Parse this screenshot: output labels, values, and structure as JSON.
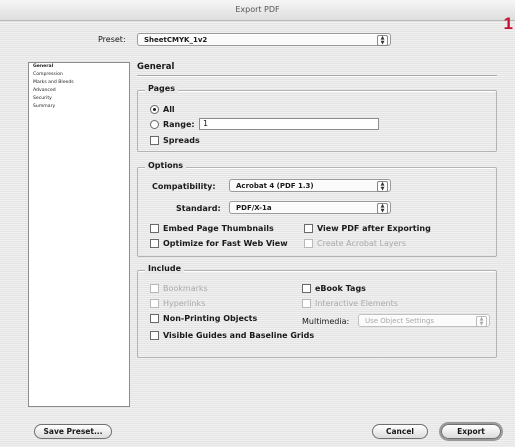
{
  "window": {
    "title": "Export PDF"
  },
  "badge": "1",
  "preset": {
    "label": "Preset:",
    "value": "SheetCMYK_1v2"
  },
  "sidebar": {
    "items": [
      {
        "label": "General"
      },
      {
        "label": "Compression"
      },
      {
        "label": "Marks and Bleeds"
      },
      {
        "label": "Advanced"
      },
      {
        "label": "Security"
      },
      {
        "label": "Summary"
      }
    ]
  },
  "panel": {
    "title": "General"
  },
  "pages": {
    "label": "Pages",
    "all_label": "All",
    "range_label": "Range:",
    "range_value": "1",
    "spreads_label": "Spreads"
  },
  "options": {
    "label": "Options",
    "compatibility_label": "Compatibility:",
    "compatibility_value": "Acrobat 4 (PDF 1.3)",
    "standard_label": "Standard:",
    "standard_value": "PDF/X-1a",
    "embed_thumbs": "Embed Page Thumbnails",
    "view_after": "View PDF after Exporting",
    "optimize": "Optimize for Fast Web View",
    "create_layers": "Create Acrobat Layers"
  },
  "include": {
    "label": "Include",
    "bookmarks": "Bookmarks",
    "ebook_tags": "eBook Tags",
    "hyperlinks": "Hyperlinks",
    "interactive": "Interactive Elements",
    "nonprinting": "Non-Printing Objects",
    "multimedia_label": "Multimedia:",
    "multimedia_value": "Use Object Settings",
    "visible_guides": "Visible Guides and Baseline Grids"
  },
  "buttons": {
    "save_preset": "Save Preset...",
    "cancel": "Cancel",
    "export": "Export"
  }
}
